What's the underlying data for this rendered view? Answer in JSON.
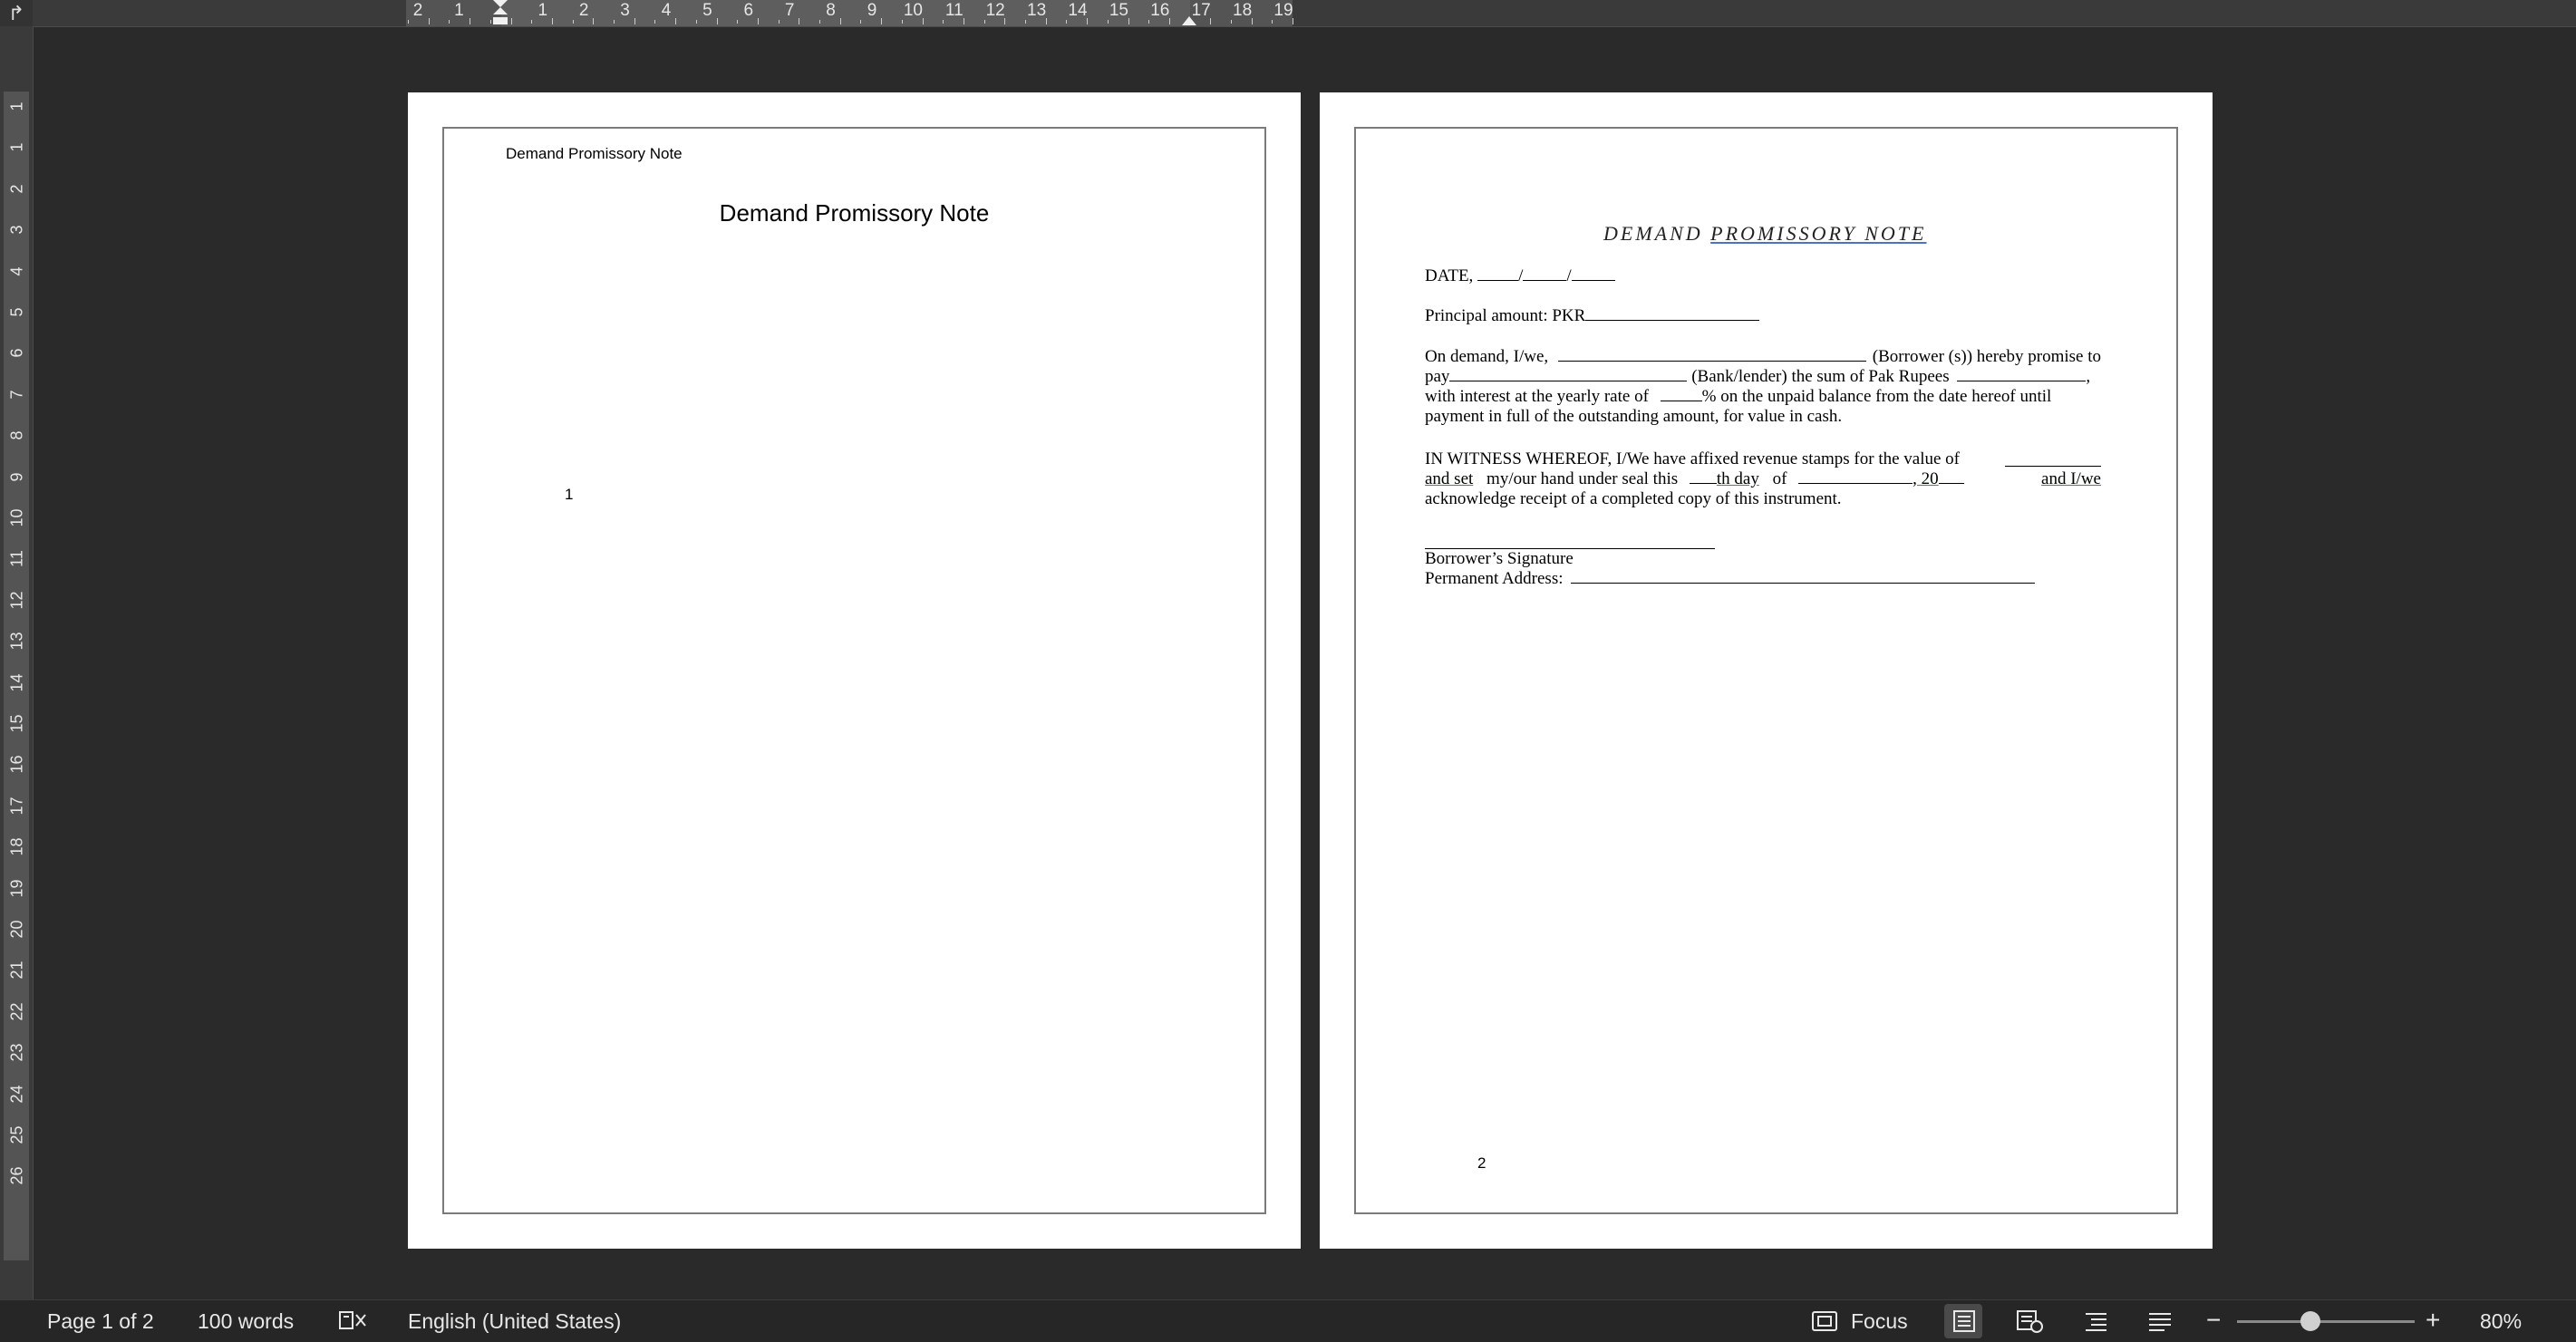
{
  "ruler_top": {
    "numbers": [
      "2",
      "1",
      "1",
      "2",
      "3",
      "4",
      "5",
      "6",
      "7",
      "8",
      "9",
      "10",
      "11",
      "12",
      "13",
      "14",
      "15",
      "16",
      "17",
      "18",
      "19"
    ]
  },
  "ruler_left": {
    "numbers": [
      "1",
      "1",
      "2",
      "3",
      "4",
      "5",
      "6",
      "7",
      "8",
      "9",
      "10",
      "11",
      "12",
      "13",
      "14",
      "15",
      "16",
      "17",
      "18",
      "19",
      "20",
      "21",
      "22",
      "23",
      "24",
      "25",
      "26"
    ]
  },
  "page1": {
    "header": "Demand Promissory Note",
    "title": "Demand Promissory Note",
    "page_number": "1"
  },
  "page2": {
    "title_a": "DEMAND ",
    "title_b": "PROMISSORY NOTE",
    "date_label": "DATE,",
    "principal_label": "Principal amount: PKR",
    "para1": {
      "l1a": "On demand, I/we,",
      "l1b": "(Borrower (s)) hereby promise to",
      "l2a": "pay",
      "l2b": "(Bank/lender) the sum of Pak Rupees",
      "l2c": ",",
      "l3a": "with interest at the yearly rate of",
      "l3b": "% on the unpaid balance from the date hereof until",
      "l4": "payment in full of the outstanding amount, for value in cash."
    },
    "para2": {
      "l1": "IN WITNESS WHEREOF, I/We have affixed revenue stamps for the value of",
      "l2a": "and set",
      "l2b": "my/our hand under seal this",
      "l2c": "th day",
      "l2d": "of",
      "l2e": ", 20",
      "l2f": "and I/we",
      "l3": "acknowledge receipt of a completed copy of this instrument."
    },
    "signature_label": "Borrower’s Signature",
    "address_label": "Permanent Address:",
    "page_number": "2"
  },
  "status_bar": {
    "page_info": "Page 1 of 2",
    "word_count": "100 words",
    "language": "English (United States)",
    "focus_label": "Focus",
    "zoom_level": "80%",
    "zoom_minus": "−",
    "zoom_plus": "+"
  }
}
